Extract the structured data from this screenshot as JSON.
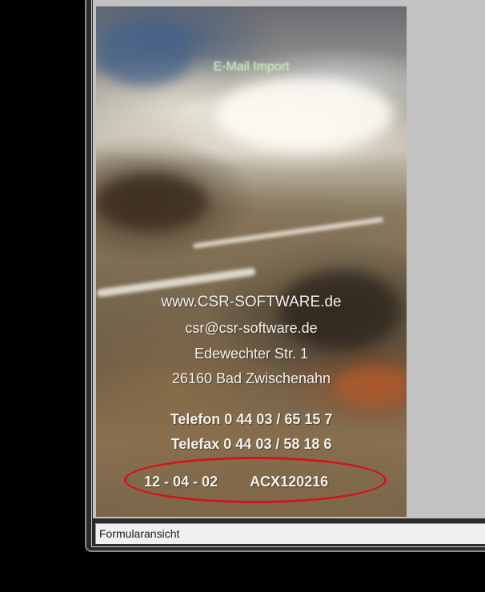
{
  "splash": {
    "title": "E-Mail Import",
    "website": "www.CSR-SOFTWARE.de",
    "email": "csr@csr-software.de",
    "street": "Edewechter Str. 1",
    "city": "26160 Bad Zwischenahn",
    "phone": "Telefon 0 44 03 / 65 15 7",
    "fax": "Telefax 0 44 03 / 58 18 6",
    "version_date": "12 - 04 - 02",
    "version_code": "ACX120216"
  },
  "statusbar": {
    "label": "Formularansicht"
  },
  "colors": {
    "highlight": "#d2141a",
    "title_text": "#b8e6a8",
    "splash_text": "#f2f0ea",
    "client_bg": "#c2c2c2",
    "statusbar_bg": "#f0f0f0"
  }
}
